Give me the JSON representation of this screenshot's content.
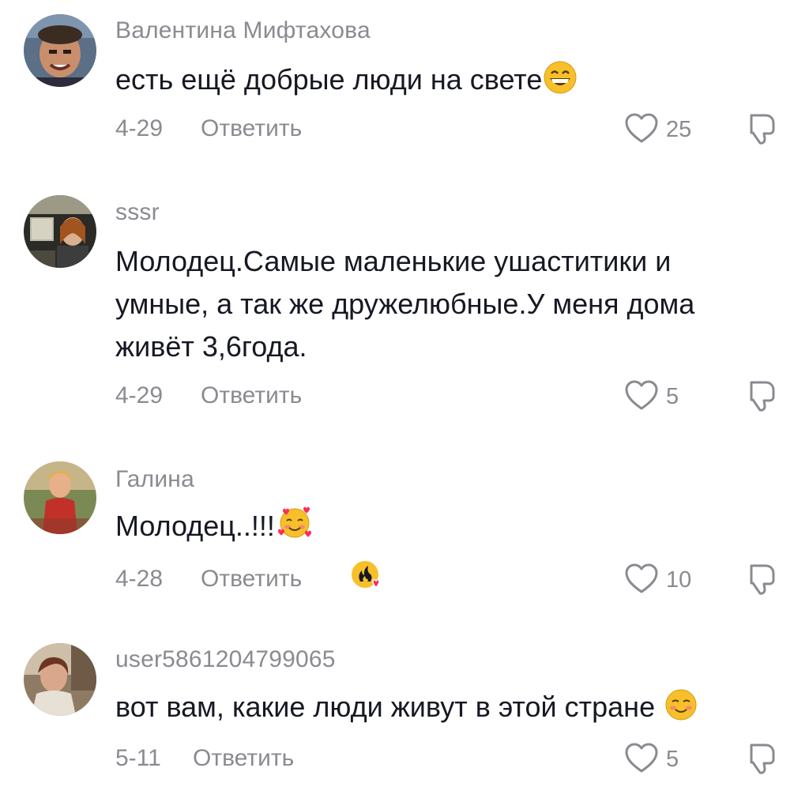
{
  "comments": [
    {
      "username": "Валентина Мифтахова",
      "text": "есть ещё добрые люди на свете",
      "emoji": "grinning-face-emoji",
      "date": "4-29",
      "reply_label": "Ответить",
      "likes": "25"
    },
    {
      "username": "sssr",
      "text": "Молодец.Самые маленькие ушаститики и умные, а так же дружелюбные.У меня дома живёт 3,6года.",
      "date": "4-29",
      "reply_label": "Ответить",
      "likes": "5"
    },
    {
      "username": "Галина",
      "text": "Молодец..!!!",
      "emoji": "smiling-face-with-hearts-emoji",
      "badge": "fire-heart-badge",
      "date": "4-28",
      "reply_label": "Ответить",
      "likes": "10"
    },
    {
      "username": "user5861204799065",
      "text": "вот вам, какие люди живут в этой стране",
      "emoji": "smiling-face-emoji",
      "date": "5-11",
      "reply_label": "Ответить",
      "likes": "5"
    }
  ],
  "colors": {
    "text_primary": "#161823",
    "text_secondary": "#8a8b91",
    "icon_stroke": "#8a8b91",
    "emoji_yellow": "#f7c02a",
    "heart_red": "#fe2c55"
  }
}
